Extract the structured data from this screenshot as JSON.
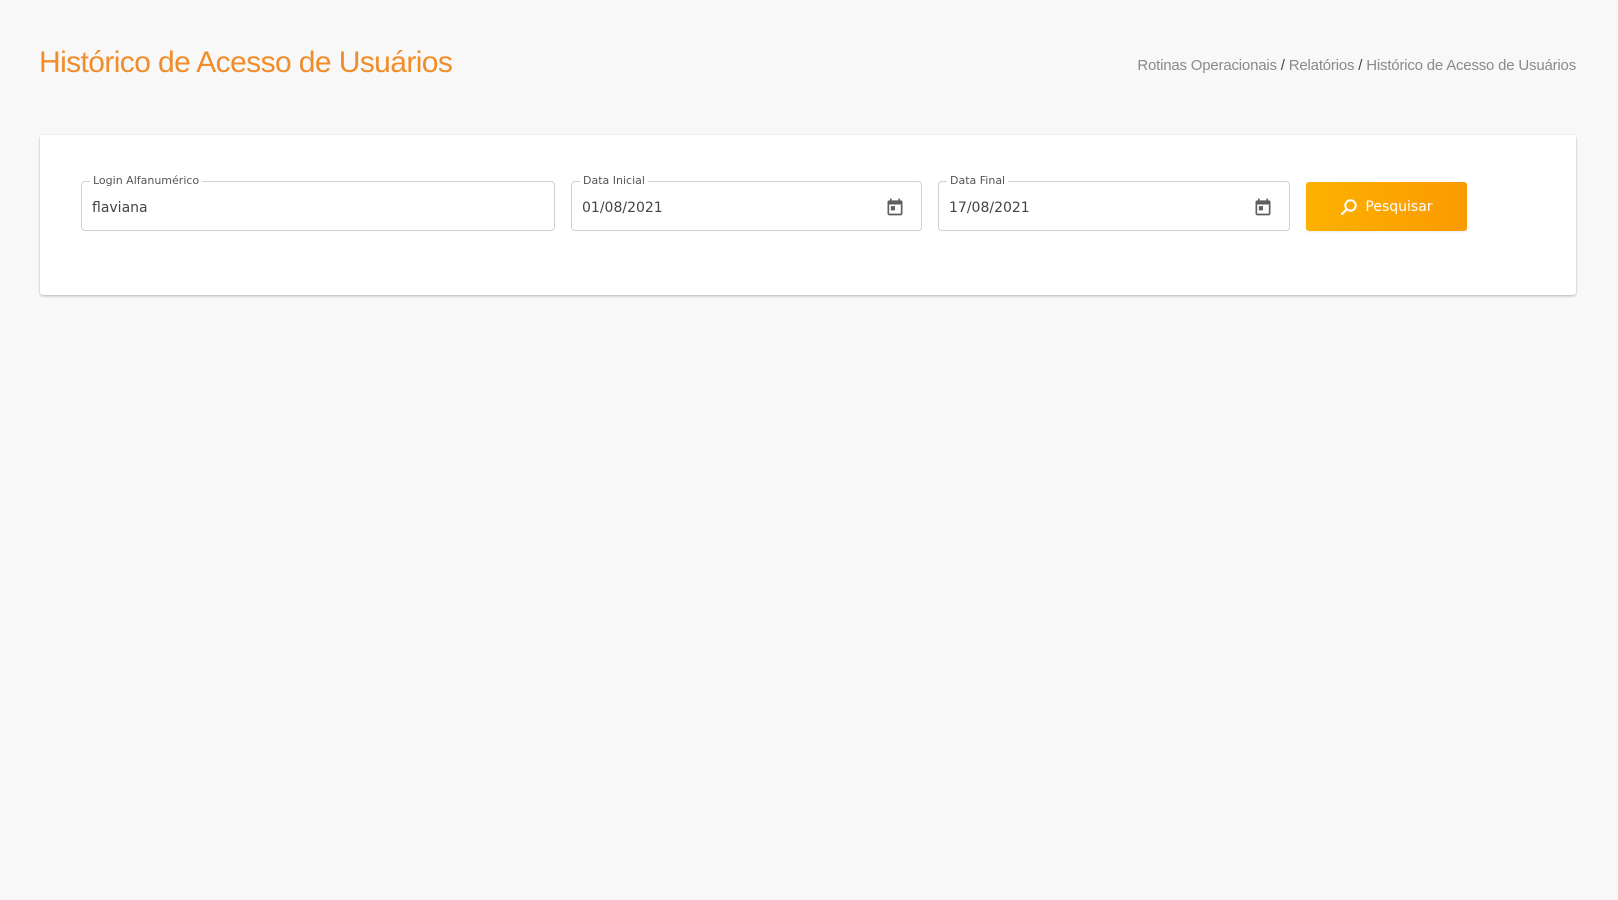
{
  "header": {
    "title": "Histórico de Acesso de Usuários",
    "breadcrumb": {
      "items": [
        "Rotinas Operacionais",
        "Relatórios"
      ],
      "separator": "/",
      "current": "Histórico de Acesso de Usuários"
    }
  },
  "filters": {
    "login": {
      "label": "Login Alfanumérico",
      "value": "flaviana"
    },
    "start_date": {
      "label": "Data Inicial",
      "value": "01/08/2021",
      "icon": "calendar-icon"
    },
    "end_date": {
      "label": "Data Final",
      "value": "17/08/2021",
      "icon": "calendar-icon"
    },
    "search_button": {
      "label": "Pesquisar",
      "icon": "search-icon"
    }
  },
  "colors": {
    "accent": "#f28c28",
    "button_gradient_start": "#fdb100",
    "button_gradient_end": "#fb9a00",
    "background": "#f8f8f8"
  }
}
